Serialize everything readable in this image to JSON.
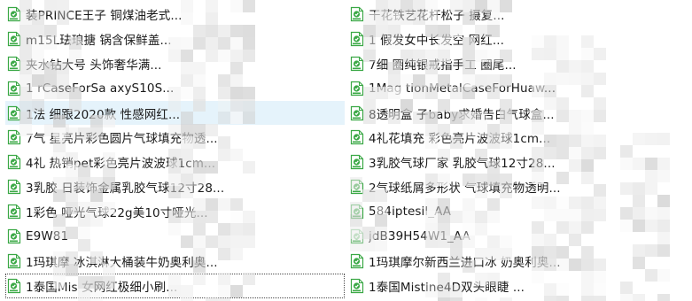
{
  "colors": {
    "icon_green": "#3aa845",
    "icon_fill": "#ffffff",
    "text": "#1a1a1a",
    "selection": "#e5f3fb"
  },
  "icon": "text-document-icon",
  "left_column": [
    {
      "name": "装PRINCE王子    铜煤油老式...",
      "selected": false,
      "focused": false
    },
    {
      "name": "m15L珐琅搪     锅含保鲜盖...",
      "selected": false,
      "focused": false
    },
    {
      "name": "夹水钻大号     头饰奢华满...",
      "selected": false,
      "focused": false
    },
    {
      "name": "1    rCaseForSa    axyS10S...",
      "selected": false,
      "focused": false
    },
    {
      "name": "1法    细跟2020款     性感网红...",
      "selected": true,
      "focused": false
    },
    {
      "name": "7气    星亮片彩色圆片气球填充物透...",
      "selected": false,
      "focused": false
    },
    {
      "name": "4礼    热销pet彩色亮片波波球1cm...",
      "selected": false,
      "focused": false
    },
    {
      "name": "3乳胶    日装饰金属乳胶气球12寸28...",
      "selected": false,
      "focused": false
    },
    {
      "name": "1彩色    哑光气球22g美10寸哑光...",
      "selected": false,
      "focused": false
    },
    {
      "name": "E9W81",
      "selected": false,
      "focused": false
    },
    {
      "name": "1玛琪摩    冰淇淋大桶装牛奶奥利奥...",
      "selected": false,
      "focused": false
    },
    {
      "name": "1泰国Mis    女网红极细小刷...",
      "selected": false,
      "focused": true
    }
  ],
  "right_column": [
    {
      "name": "    干花铁艺花杆松子    摄复...",
      "selected": false,
      "focused": false
    },
    {
      "name": "1    假发女中长发空    网红...",
      "selected": false,
      "focused": false
    },
    {
      "name": "7细    圈纯银戒指手工    圈尾...",
      "selected": false,
      "focused": false
    },
    {
      "name": "1Mag    tionMetalCaseForHuaw...",
      "selected": false,
      "focused": false
    },
    {
      "name": "8透明盒    子baby求婚告白气球盒...",
      "selected": false,
      "focused": false
    },
    {
      "name": "4礼花填充    彩色亮片波波球1cm...",
      "selected": false,
      "focused": false
    },
    {
      "name": "3乳胶气球厂家    乳胶气球12寸28...",
      "selected": false,
      "focused": false
    },
    {
      "name": "2气球纸屑多形状    气球填充物透明...",
      "selected": false,
      "focused": false
    },
    {
      "name": "584iptesil_AA",
      "selected": false,
      "focused": false
    },
    {
      "name": "jdB39H54W1_AA",
      "selected": false,
      "focused": false
    },
    {
      "name": "1玛琪摩尔新西兰进口冰    奶奥利奥...",
      "selected": false,
      "focused": false
    },
    {
      "name": "1泰国Mistine4D双头眼睫    ...",
      "selected": false,
      "focused": false
    }
  ]
}
